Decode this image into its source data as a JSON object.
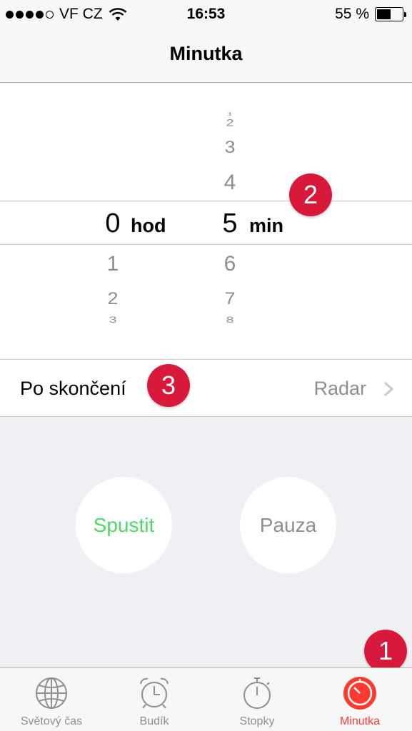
{
  "status_bar": {
    "carrier": "VF CZ",
    "time": "16:53",
    "battery_percent": "55 %",
    "signal_bars_filled": 4,
    "signal_bars_total": 5,
    "battery_level": 0.55
  },
  "nav": {
    "title": "Minutka"
  },
  "picker": {
    "hours": {
      "above": [],
      "selected": "0",
      "below": [
        "1",
        "2",
        "3"
      ],
      "unit": "hod"
    },
    "minutes": {
      "above": [
        "1",
        "2",
        "3",
        "4"
      ],
      "selected": "5",
      "below": [
        "6",
        "7",
        "8"
      ],
      "unit": "min"
    }
  },
  "after_row": {
    "label": "Po skončení",
    "value": "Radar"
  },
  "buttons": {
    "start": "Spustit",
    "pause": "Pauza"
  },
  "badges": [
    "1",
    "2",
    "3"
  ],
  "tabs": [
    {
      "label": "Světový čas",
      "icon": "globe-icon",
      "active": false
    },
    {
      "label": "Budík",
      "icon": "alarm-clock-icon",
      "active": false
    },
    {
      "label": "Stopky",
      "icon": "stopwatch-icon",
      "active": false
    },
    {
      "label": "Minutka",
      "icon": "timer-icon",
      "active": true
    }
  ],
  "colors": {
    "accent": "#ff3b30",
    "start": "#4cd964",
    "badge": "#d8193b",
    "secondary_text": "#8e8e93"
  }
}
